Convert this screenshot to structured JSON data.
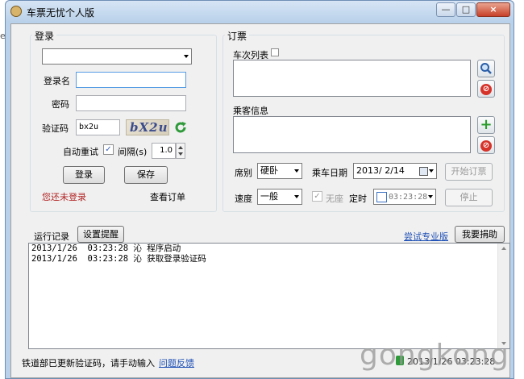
{
  "window": {
    "title": "车票无忧个人版",
    "controls": {
      "minimize": "—",
      "maximize": "□",
      "close": "×"
    }
  },
  "behind_text": "epia",
  "login": {
    "group_title": "登录",
    "account_combo_value": "",
    "username_label": "登录名",
    "username_value": "",
    "password_label": "密码",
    "password_value": "",
    "captcha_label": "验证码",
    "captcha_value": "bx2u",
    "captcha_image_text": "bX2u",
    "auto_retry_label": "自动重试",
    "auto_retry_checked": "✓",
    "interval_label": "间隔(s)",
    "interval_value": "1.0",
    "login_button": "登录",
    "save_button": "保存",
    "status_text": "您还未登录",
    "view_orders_link": "查看订单"
  },
  "order": {
    "group_title": "订票",
    "train_list_label": "车次列表",
    "passenger_label": "乘客信息",
    "seat_label": "席别",
    "seat_value": "硬卧",
    "date_label": "乘车日期",
    "date_value": "2013/ 2/14",
    "start_button": "开始订票",
    "speed_label": "速度",
    "speed_value": "一般",
    "no_seat_checked": "✓",
    "no_seat_label": "无座",
    "timer_label": "定时",
    "time_value": "03:23:28",
    "stop_button": "停止"
  },
  "log": {
    "label": "运行记录",
    "reminder_button": "设置提醒",
    "pro_link": "尝试专业版",
    "donate_button": "我要捐助",
    "lines": [
      "2013/1/26  03:23:28 沁 程序启动",
      "2013/1/26  03:23:28 沁 获取登录验证码"
    ]
  },
  "statusbar": {
    "message": "铁道部已更新验证码，请手动输入",
    "feedback_link": "问题反馈",
    "time_text": "2013/1/26 03:23:28"
  },
  "watermark": "gongkong",
  "icons": {
    "search": "search-icon",
    "remove": "remove-icon",
    "add": "add-icon",
    "refresh": "refresh-icon",
    "calendar": "calendar-icon"
  },
  "colors": {
    "status_red": "#b22222",
    "link_blue": "#1d4fb5",
    "title_bg": "#b9d1ea"
  }
}
